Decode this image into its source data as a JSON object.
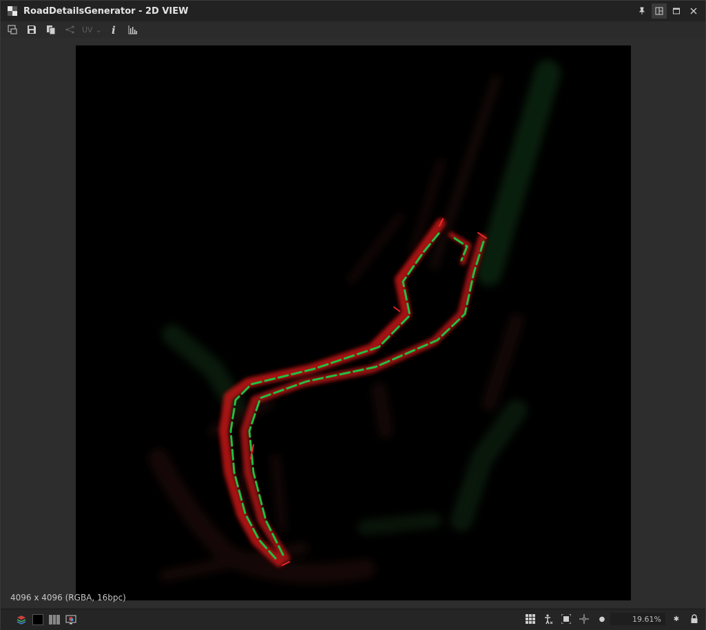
{
  "window": {
    "title": "RoadDetailsGenerator - 2D VIEW"
  },
  "toolbar": {
    "uv_label": "UV"
  },
  "viewport": {
    "resolution_label": "4096 x 4096 (RGBA, 16bpc)"
  },
  "statusbar": {
    "zoom_value": "19.61%"
  },
  "colors": {
    "road_red": "#e01a1a",
    "road_green": "#22c040",
    "background": "#000000"
  }
}
